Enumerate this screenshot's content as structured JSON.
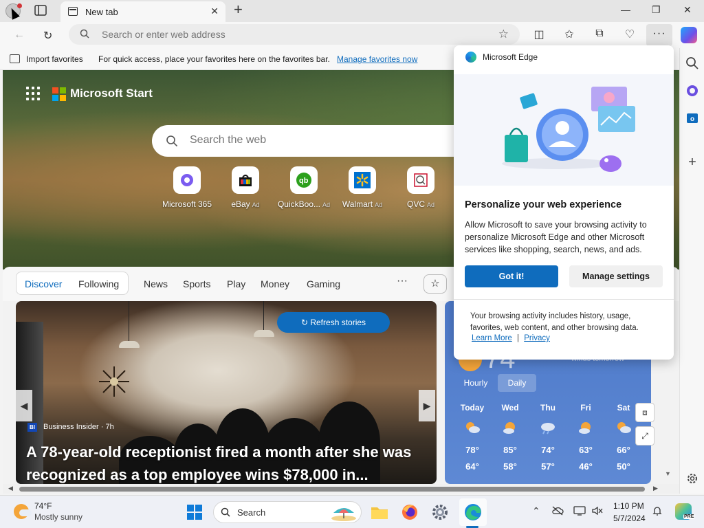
{
  "browser": {
    "tab_title": "New tab",
    "address_placeholder": "Search or enter web address"
  },
  "favorites_bar": {
    "import_label": "Import favorites",
    "hint": "For quick access, place your favorites here on the favorites bar.",
    "manage_link": "Manage favorites now"
  },
  "start_page": {
    "brand": "Microsoft Start",
    "search_placeholder": "Search the web",
    "quick_links": [
      {
        "label": "Microsoft 365",
        "ad": ""
      },
      {
        "label": "eBay",
        "ad": "Ad"
      },
      {
        "label": "QuickBoo...",
        "ad": "Ad"
      },
      {
        "label": "Walmart",
        "ad": "Ad"
      },
      {
        "label": "QVC",
        "ad": "Ad"
      }
    ],
    "feed_tabs": {
      "discover": "Discover",
      "following": "Following",
      "items": [
        "News",
        "Sports",
        "Play",
        "Money",
        "Gaming"
      ],
      "more": "···"
    },
    "story": {
      "refresh_label": "Refresh stories",
      "source_badge": "BI",
      "source": "Business Insider · 7h",
      "headline": "A 78-year-old receptionist fired a month after she was recognized as a top employee wins $78,000 in..."
    },
    "weather": {
      "current_temp": "74°",
      "winds_note": "winds tomorrow",
      "toggle": [
        "Hourly",
        "Daily"
      ],
      "days": [
        {
          "name": "Today",
          "hi": "78°",
          "lo": "64°",
          "icon": "partly-cloudy-icon"
        },
        {
          "name": "Wed",
          "hi": "85°",
          "lo": "58°",
          "icon": "sun-cloud-icon"
        },
        {
          "name": "Thu",
          "hi": "74°",
          "lo": "57°",
          "icon": "rain-cloud-icon"
        },
        {
          "name": "Fri",
          "hi": "63°",
          "lo": "46°",
          "icon": "sun-cloud-icon"
        },
        {
          "name": "Sat",
          "hi": "66°",
          "lo": "50°",
          "icon": "partly-cloudy-icon"
        }
      ]
    }
  },
  "popup": {
    "title": "Microsoft Edge",
    "heading": "Personalize your web experience",
    "body": "Allow Microsoft to save your browsing activity to personalize Microsoft Edge and other Microsoft services like shopping, search, news, and ads.",
    "primary": "Got it!",
    "secondary": "Manage settings",
    "footnote": "Your browsing activity includes history, usage, favorites, web content, and other browsing data.",
    "learn_more": "Learn More",
    "separator": "|",
    "privacy": "Privacy"
  },
  "taskbar": {
    "weather_temp": "74°F",
    "weather_cond": "Mostly sunny",
    "search_label": "Search",
    "time": "1:10 PM",
    "date": "5/7/2024",
    "copilot_badge": "PRE"
  },
  "colors": {
    "accent": "#0f6cbd",
    "weather_bg": "#5e89d4"
  }
}
